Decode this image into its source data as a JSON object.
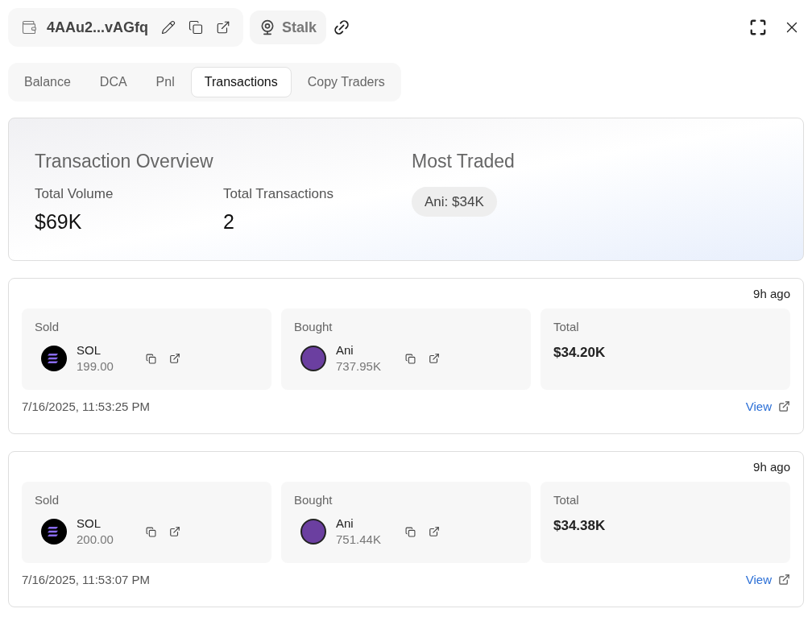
{
  "header": {
    "wallet": "4AAu2...vAGfq",
    "stalk": "Stalk"
  },
  "tabs": [
    {
      "label": "Balance",
      "selected": false
    },
    {
      "label": "DCA",
      "selected": false
    },
    {
      "label": "Pnl",
      "selected": false
    },
    {
      "label": "Transactions",
      "selected": true
    },
    {
      "label": "Copy Traders",
      "selected": false
    }
  ],
  "overview": {
    "title": "Transaction Overview",
    "stats": [
      {
        "label": "Total Volume",
        "value": "$69K"
      },
      {
        "label": "Total Transactions",
        "value": "2"
      }
    ],
    "most_traded": {
      "title": "Most Traded",
      "tag": "Ani: $34K"
    }
  },
  "transactions": [
    {
      "time_ago": "9h ago",
      "sold": {
        "label": "Sold",
        "token": "SOL",
        "kind": "sol",
        "amount": "199.00"
      },
      "bought": {
        "label": "Bought",
        "token": "Ani",
        "kind": "avatar",
        "amount": "737.95K"
      },
      "total": {
        "label": "Total",
        "value": "$34.20K"
      },
      "date": "7/16/2025, 11:53:25 PM",
      "link": "View"
    },
    {
      "time_ago": "9h ago",
      "sold": {
        "label": "Sold",
        "token": "SOL",
        "kind": "sol",
        "amount": "200.00"
      },
      "bought": {
        "label": "Bought",
        "token": "Ani",
        "kind": "avatar",
        "amount": "751.44K"
      },
      "total": {
        "label": "Total",
        "value": "$34.38K"
      },
      "date": "7/16/2025, 11:53:07 PM",
      "link": "View"
    }
  ]
}
